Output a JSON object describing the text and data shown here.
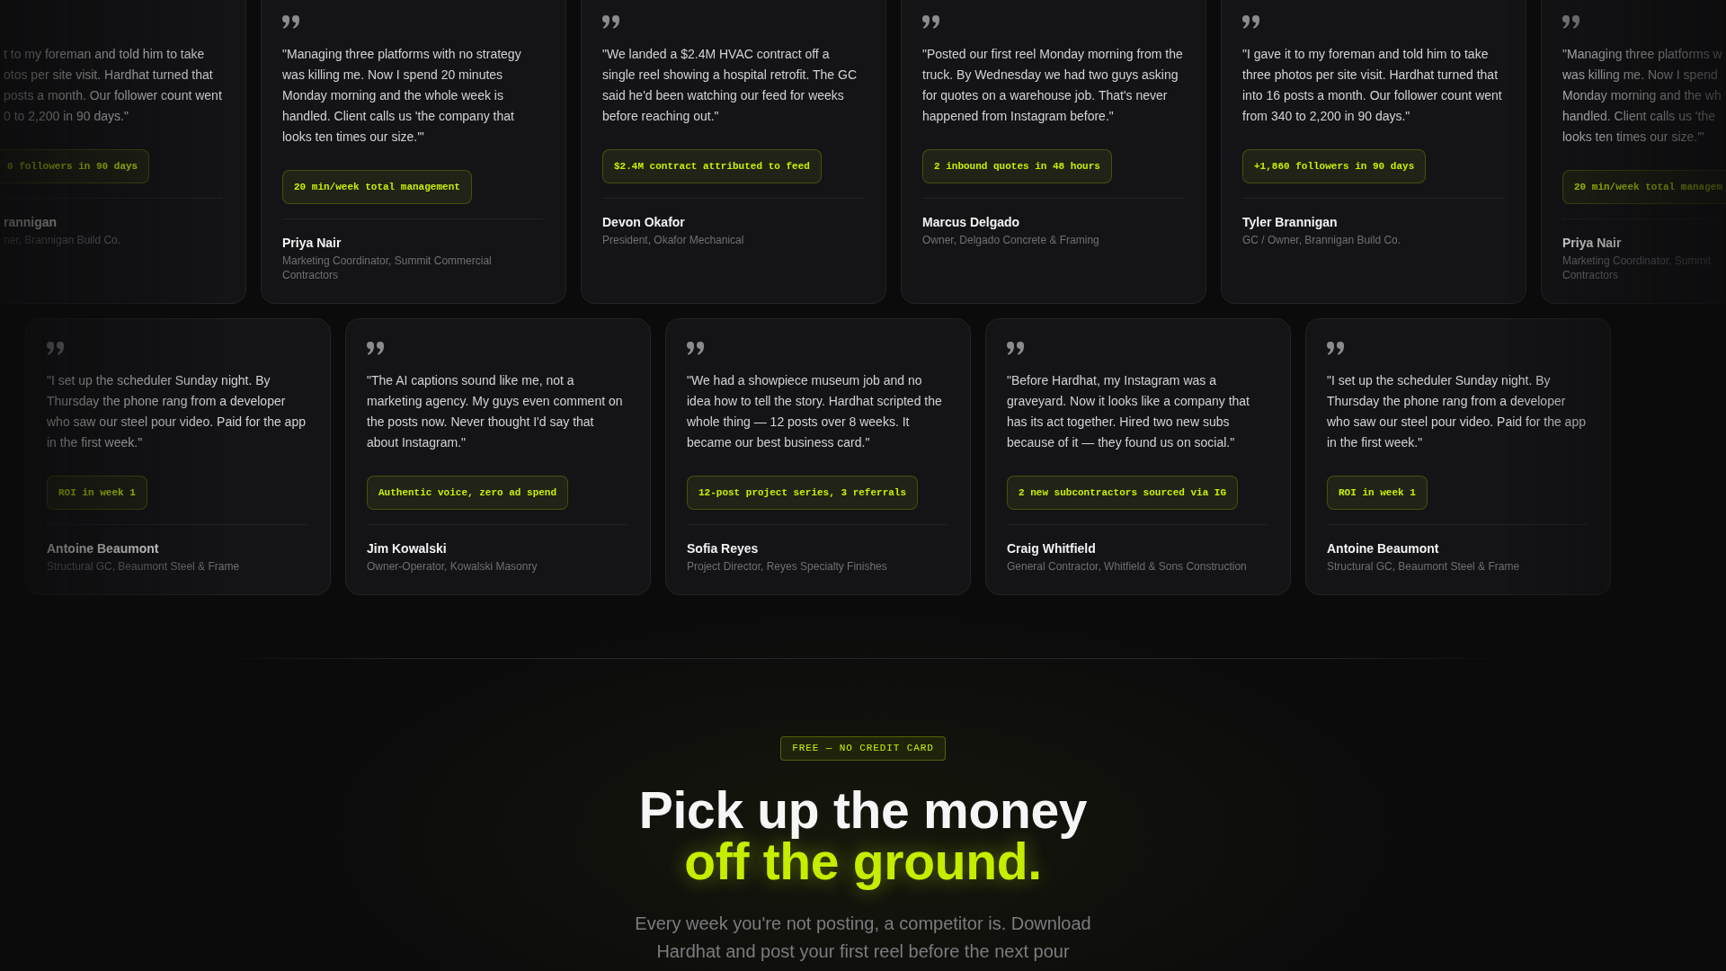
{
  "testimonials": {
    "rows": [
      {
        "cards": [
          {
            "kind": "left_cut",
            "quote_lines": [
              "t to my foreman and told him to take",
              "otos per site visit. Hardhat turned that",
              "posts a month. Our follower count went",
              "0 to 2,200 in 90 days.\""
            ],
            "result": "0 followers in 90 days",
            "name": "rannigan",
            "role_lines": [
              "ner, Brannigan Build Co."
            ]
          },
          {
            "kind": "full",
            "quote": "\"Managing three platforms with no strategy was killing me. Now I spend 20 minutes Monday morning and the whole week is handled. Client calls us 'the company that looks ten times our size.'\"",
            "result": "20 min/week total management",
            "name": "Priya Nair",
            "role": "Marketing Coordinator, Summit Commercial Contractors"
          },
          {
            "kind": "full",
            "quote": "\"We landed a $2.4M HVAC contract off a single reel showing a hospital retrofit. The GC said he'd been watching our feed for weeks before reaching out.\"",
            "result": "$2.4M contract attributed to feed",
            "name": "Devon Okafor",
            "role": "President, Okafor Mechanical"
          },
          {
            "kind": "full",
            "quote": "\"Posted our first reel Monday morning from the truck. By Wednesday we had two guys asking for quotes on a warehouse job. That's never happened from Instagram before.\"",
            "result": "2 inbound quotes in 48 hours",
            "name": "Marcus Delgado",
            "role": "Owner, Delgado Concrete & Framing"
          },
          {
            "kind": "full",
            "quote": "\"I gave it to my foreman and told him to take three photos per site visit. Hardhat turned that into 16 posts a month. Our follower count went from 340 to 2,200 in 90 days.\"",
            "result": "+1,860 followers in 90 days",
            "name": "Tyler Brannigan",
            "role": "GC / Owner, Brannigan Build Co."
          },
          {
            "kind": "right_cut",
            "quote_lines": [
              "\"Managing three platforms w",
              "was killing me. Now I spend",
              "Monday morning and the wh",
              "handled. Client calls us 'the",
              "looks ten times our size.'\""
            ],
            "result": "20 min/week total managem",
            "name": "Priya Nair",
            "role_lines": [
              "Marketing Coordinator, Summit",
              "Contractors"
            ]
          }
        ]
      },
      {
        "cards": [
          {
            "kind": "full",
            "quote": "\"I set up the scheduler Sunday night. By Thursday the phone rang from a developer who saw our steel pour video. Paid for the app in the first week.\"",
            "result": "ROI in week 1",
            "name": "Antoine Beaumont",
            "role": "Structural GC, Beaumont Steel & Frame"
          },
          {
            "kind": "full",
            "quote": "\"The AI captions sound like me, not a marketing agency. My guys even comment on the posts now. Never thought I'd say that about Instagram.\"",
            "result": "Authentic voice, zero ad spend",
            "name": "Jim Kowalski",
            "role": "Owner-Operator, Kowalski Masonry"
          },
          {
            "kind": "full",
            "quote": "\"We had a showpiece museum job and no idea how to tell the story. Hardhat scripted the whole thing — 12 posts over 8 weeks. It became our best business card.\"",
            "result": "12-post project series, 3 referrals",
            "name": "Sofia Reyes",
            "role": "Project Director, Reyes Specialty Finishes"
          },
          {
            "kind": "full",
            "quote": "\"Before Hardhat, my Instagram was a graveyard. Now it looks like a company that has its act together. Hired two new subs because of it — they found us on social.\"",
            "result": "2 new subcontractors sourced via IG",
            "name": "Craig Whitfield",
            "role": "General Contractor, Whitfield & Sons Construction"
          },
          {
            "kind": "full",
            "quote": "\"I set up the scheduler Sunday night. By Thursday the phone rang from a developer who saw our steel pour video. Paid for the app in the first week.\"",
            "result": "ROI in week 1",
            "name": "Antoine Beaumont",
            "role": "Structural GC, Beaumont Steel & Frame"
          }
        ]
      }
    ]
  },
  "cta": {
    "tag": "FREE — NO CREDIT CARD",
    "headline": "Pick up the money",
    "headline_accent": "off the ground.",
    "description": "Every week you're not posting, a competitor is. Download Hardhat and post your first reel before the next pour"
  }
}
